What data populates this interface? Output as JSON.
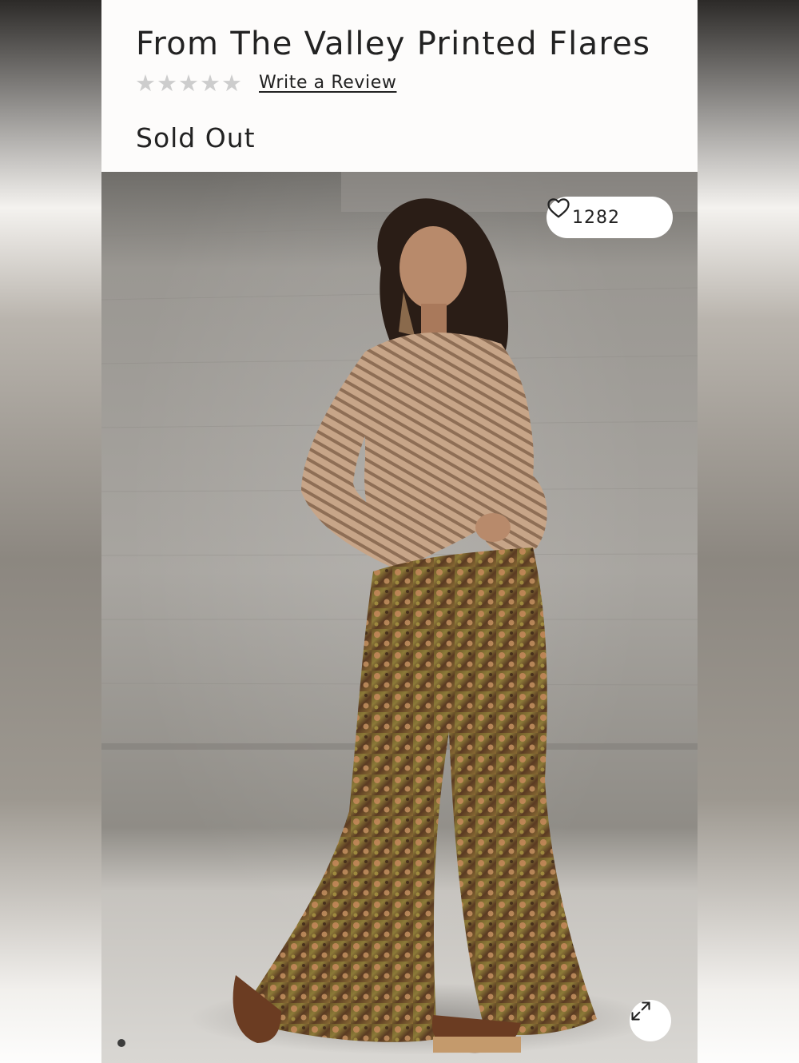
{
  "product": {
    "title": "From The Valley Printed Flares",
    "rating_stars": [
      "★",
      "★",
      "★",
      "★",
      "★"
    ],
    "rating_value": 0,
    "review_link": "Write a Review",
    "status": "Sold Out"
  },
  "gallery": {
    "likes_count": "1282",
    "heart_icon": "heart-outline-icon",
    "expand_icon": "expand-arrows-icon",
    "current_slide_dot": 1
  },
  "colors": {
    "text": "#222222",
    "star_empty": "#cdcdcd",
    "page_background": "#fdfcfb"
  }
}
